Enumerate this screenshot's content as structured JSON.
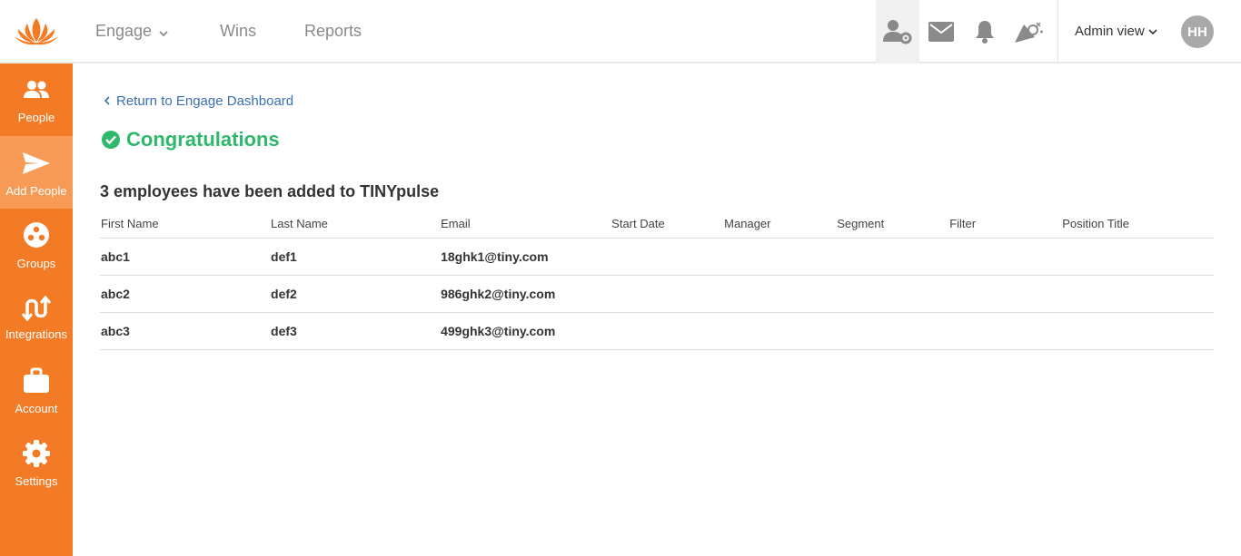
{
  "colors": {
    "brand_orange": "#f47b26",
    "sidebar_active": "#f69a55",
    "success_green": "#2eb86b",
    "link_blue": "#3a6fb0"
  },
  "topbar": {
    "logo_icon": "lotus-logo-icon",
    "nav": [
      {
        "label": "Engage"
      },
      {
        "label": "Wins"
      },
      {
        "label": "Reports"
      }
    ],
    "icons": [
      "admin-settings-icon",
      "mail-icon",
      "bell-icon",
      "celebration-icon"
    ],
    "admin_view_label": "Admin view",
    "avatar_initials": "HH"
  },
  "sidebar": {
    "items": [
      {
        "label": "People",
        "icon": "people-icon"
      },
      {
        "label": "Add People",
        "icon": "send-icon",
        "active": true
      },
      {
        "label": "Groups",
        "icon": "groups-icon"
      },
      {
        "label": "Integrations",
        "icon": "integrations-icon"
      },
      {
        "label": "Account",
        "icon": "briefcase-icon"
      },
      {
        "label": "Settings",
        "icon": "gear-icon"
      }
    ]
  },
  "main": {
    "back_link": "Return to Engage Dashboard",
    "congrats": "Congratulations",
    "summary": "3 employees have been added to TINYpulse",
    "table": {
      "headers": [
        "First Name",
        "Last Name",
        "Email",
        "Start Date",
        "Manager",
        "Segment",
        "Filter",
        "Position Title"
      ],
      "rows": [
        [
          "abc1",
          "def1",
          "18ghk1@tiny.com",
          "",
          "",
          "",
          "",
          ""
        ],
        [
          "abc2",
          "def2",
          "986ghk2@tiny.com",
          "",
          "",
          "",
          "",
          ""
        ],
        [
          "abc3",
          "def3",
          "499ghk3@tiny.com",
          "",
          "",
          "",
          "",
          ""
        ]
      ]
    }
  }
}
